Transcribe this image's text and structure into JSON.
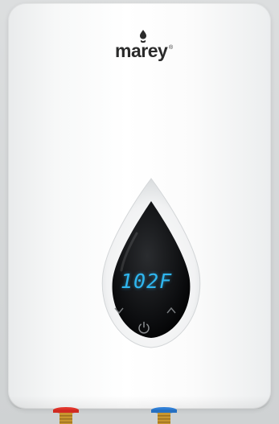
{
  "brand": {
    "name": "marey",
    "registered_mark": "®"
  },
  "display": {
    "temperature": "102F",
    "digit_color": "#2fb6ef"
  },
  "controls": {
    "down_icon": "chevron-down-icon",
    "up_icon": "chevron-up-icon",
    "power_icon": "power-icon"
  },
  "fittings": {
    "hot_color": "#e1352b",
    "cold_color": "#2f7fd6",
    "brass_color": "#c8962f"
  }
}
